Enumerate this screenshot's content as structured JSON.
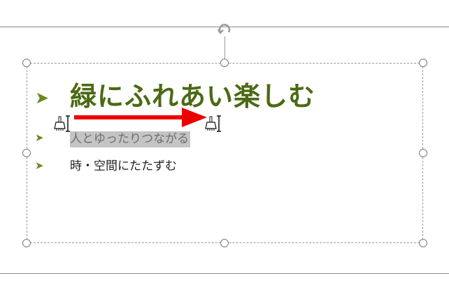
{
  "slide": {
    "bullets": [
      {
        "text": "緑にふれあい楽しむ",
        "level": 1
      },
      {
        "text": "人とゆったりつながる",
        "level": 2,
        "selected": true
      },
      {
        "text": "時・空間にたたずむ",
        "level": 2,
        "selected": false
      }
    ],
    "bullet_glyph": "➤"
  },
  "colors": {
    "heading": "#4a6a14",
    "bullet": "#6a8a1f",
    "selection": "#c4c4c4",
    "arrow": "#ee0000"
  },
  "icons": {
    "rotate": "rotate-handle-icon",
    "format_painter": "format-painter-cursor-icon",
    "arrow": "right-arrow-icon"
  }
}
